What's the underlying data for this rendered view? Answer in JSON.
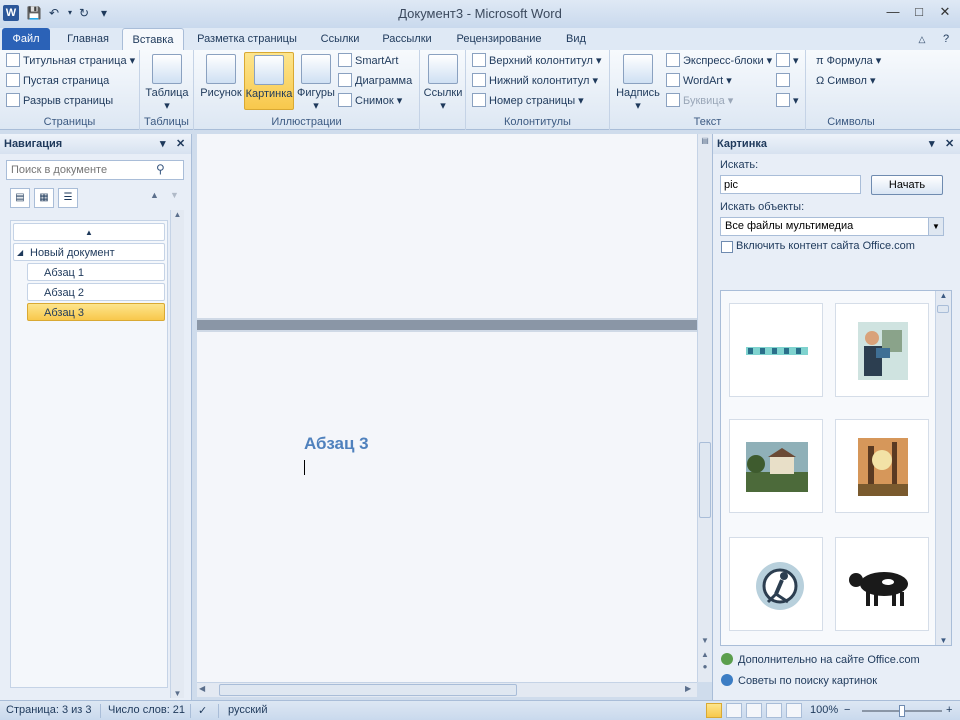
{
  "window": {
    "title": "Документ3  -  Microsoft Word",
    "app_icon": "W",
    "controls": [
      "minimize-icon",
      "maximize-icon",
      "close-icon"
    ]
  },
  "quick_access": [
    "save-icon",
    "undo-icon",
    "redo-icon",
    "customize-icon"
  ],
  "tabs": [
    {
      "label": "Файл"
    },
    {
      "label": "Главная"
    },
    {
      "label": "Вставка",
      "active": true
    },
    {
      "label": "Разметка страницы"
    },
    {
      "label": "Ссылки"
    },
    {
      "label": "Рассылки"
    },
    {
      "label": "Рецензирование"
    },
    {
      "label": "Вид"
    }
  ],
  "ribbon": {
    "pages": {
      "label": "Страницы",
      "cover": "Титульная страница",
      "blank": "Пустая страница",
      "break": "Разрыв страницы"
    },
    "tables": {
      "label": "Таблицы",
      "table": "Таблица"
    },
    "illustrations": {
      "label": "Иллюстрации",
      "picture": "Рисунок",
      "clipart": "Картинка",
      "shapes": "Фигуры",
      "smartart": "SmartArt",
      "chart": "Диаграмма",
      "screenshot": "Снимок"
    },
    "links": {
      "label": "",
      "links": "Ссылки"
    },
    "headerfooter": {
      "label": "Колонтитулы",
      "header": "Верхний колонтитул",
      "footer": "Нижний колонтитул",
      "pagenum": "Номер страницы"
    },
    "text": {
      "label": "Текст",
      "textbox": "Надпись",
      "quickparts": "Экспресс-блоки",
      "wordart": "WordArt",
      "dropcap": "Буквица"
    },
    "symbols": {
      "label": "Символы",
      "equation": "Формула",
      "symbol": "Символ"
    }
  },
  "nav_pane": {
    "title": "Навигация",
    "search_placeholder": "Поиск в документе",
    "tree": [
      {
        "label": "Новый документ"
      },
      {
        "label": "Абзац 1"
      },
      {
        "label": "Абзац 2"
      },
      {
        "label": "Абзац 3",
        "selected": true
      }
    ]
  },
  "document": {
    "heading": "Абзац 3"
  },
  "clipart_pane": {
    "title": "Картинка",
    "search_label": "Искать:",
    "search_value": "pic",
    "go_button": "Начать",
    "objects_label": "Искать объекты:",
    "objects_value": "Все файлы мультимедиа",
    "include_office": "Включить контент сайта Office.com",
    "results": [
      "border-clip",
      "businessman-clip",
      "house-clip",
      "forest-clip",
      "runner-gear-clip",
      "cow-clip"
    ],
    "link_more": "Дополнительно на сайте Office.com",
    "link_tips": "Советы по поиску картинок"
  },
  "status": {
    "page": "Страница: 3 из 3",
    "words": "Число слов: 21",
    "language": "русский",
    "zoom": "100%"
  },
  "colors": {
    "accent": "#2b62b7",
    "heading": "#4f81bd",
    "highlight": "#f8c84c"
  }
}
